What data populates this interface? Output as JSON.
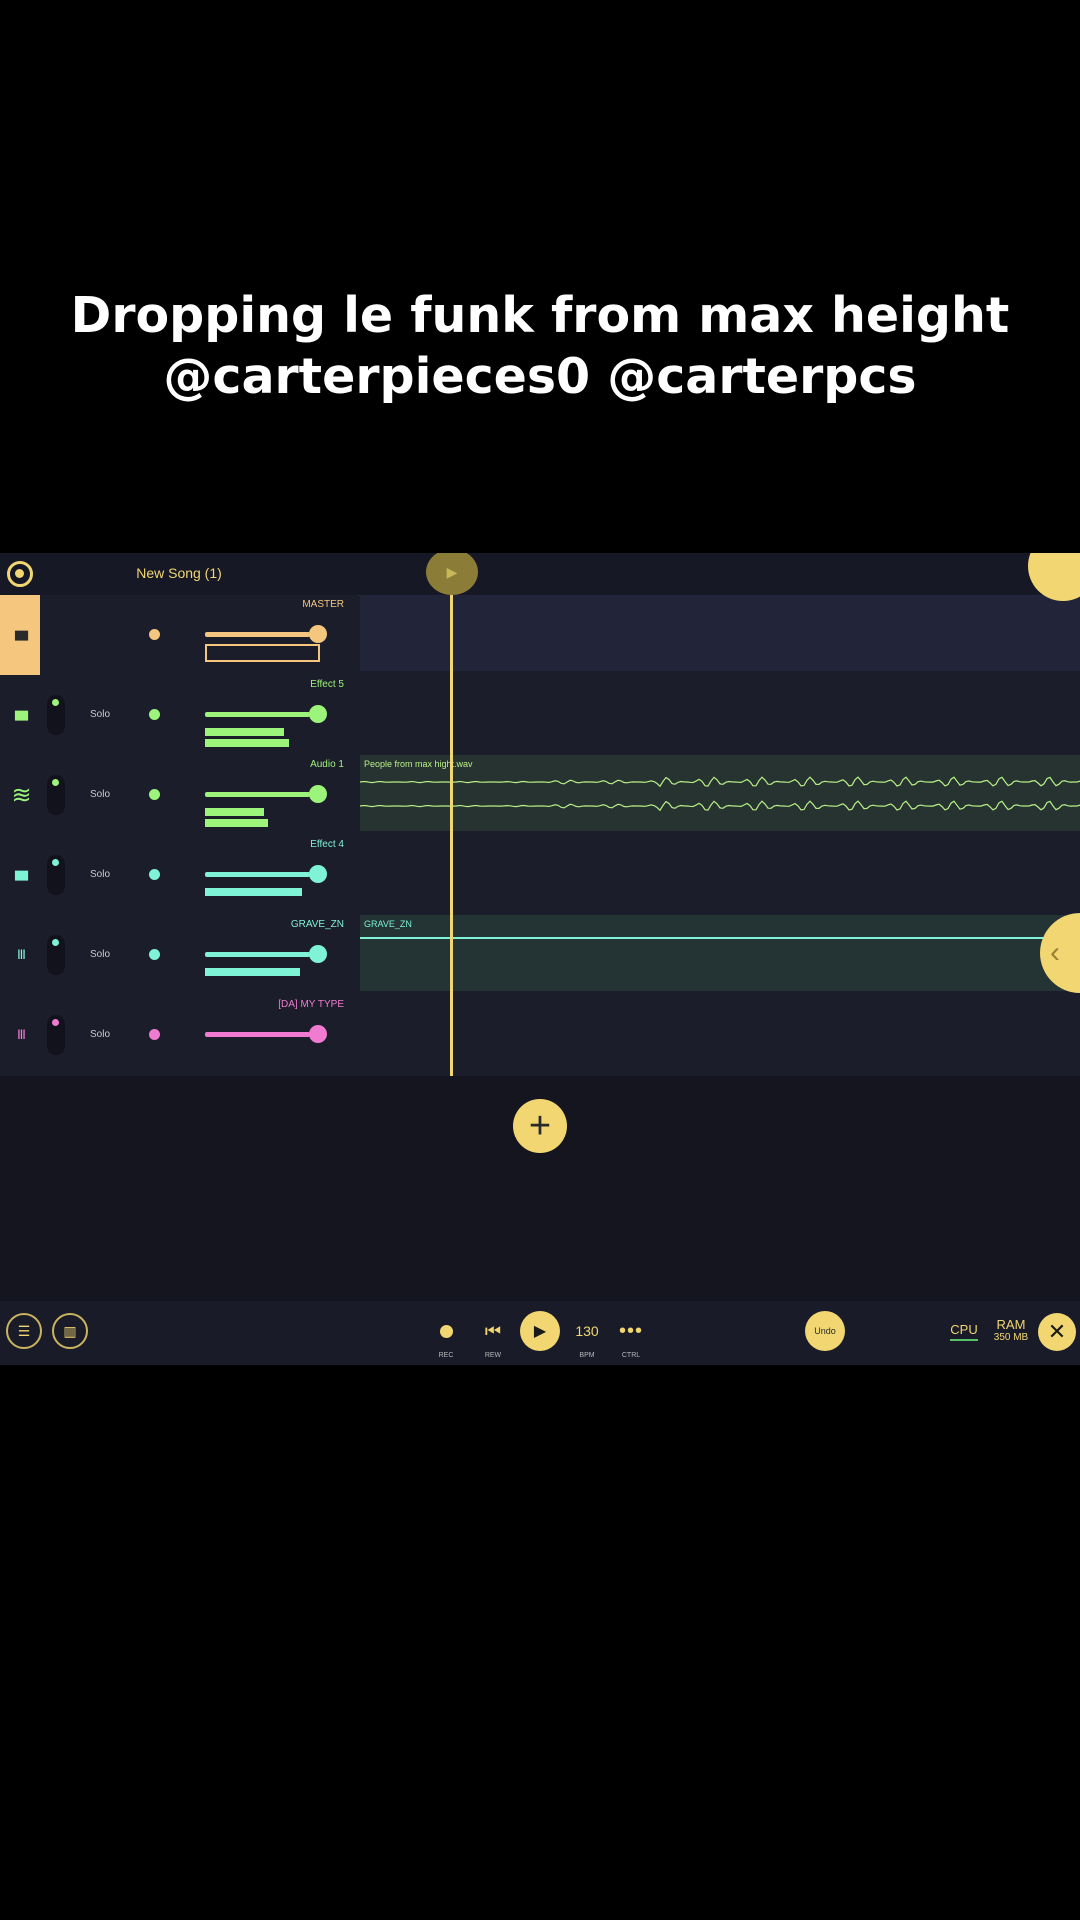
{
  "caption": {
    "line1": "Dropping le funk from max height",
    "line2": "@carterpieces0 @carterpcs"
  },
  "app": {
    "song_title": "New Song (1)",
    "add_track_symbol": "+",
    "side_tab_symbol": "‹"
  },
  "tracks": [
    {
      "name": "MASTER",
      "color": "#f5c77e",
      "icon": "master-bars-icon",
      "solo": "",
      "meter1": 0.9,
      "meter2": 0
    },
    {
      "name": "Effect 5",
      "color": "#9cf57a",
      "icon": "effect-bars-icon",
      "solo": "Solo",
      "meter1": 0.62,
      "meter2": 0.66
    },
    {
      "name": "Audio 1",
      "color": "#9cf57a",
      "icon": "waveform-icon",
      "solo": "Solo",
      "meter1": 0.46,
      "meter2": 0.49
    },
    {
      "name": "Effect 4",
      "color": "#7ff3d6",
      "icon": "effect-bars-icon",
      "solo": "Solo",
      "meter1": 0.76,
      "meter2": 0
    },
    {
      "name": "GRAVE_ZN",
      "color": "#7ff3d6",
      "icon": "piano-icon",
      "solo": "Solo",
      "meter1": 0.74,
      "meter2": 0
    },
    {
      "name": "[DA] MY TYPE",
      "color": "#f17bd0",
      "icon": "piano-icon",
      "solo": "Solo",
      "meter1": 0,
      "meter2": 0
    }
  ],
  "clips": {
    "audio": {
      "name": "People from max hight.wav",
      "color": "#b8f087"
    },
    "grave": {
      "name": "GRAVE_ZN",
      "color": "#7ff3d6"
    }
  },
  "transport": {
    "rec_label": "REC",
    "rew_label": "REW",
    "bpm_value": "130",
    "bpm_label": "BPM",
    "ctrl_symbol": "•••",
    "ctrl_label": "CTRL",
    "undo_label": "Undo",
    "cpu_label": "CPU",
    "ram_label": "RAM",
    "ram_value": "350 MB",
    "close_symbol": "✕"
  },
  "colors": {
    "accent": "#f1d671"
  }
}
